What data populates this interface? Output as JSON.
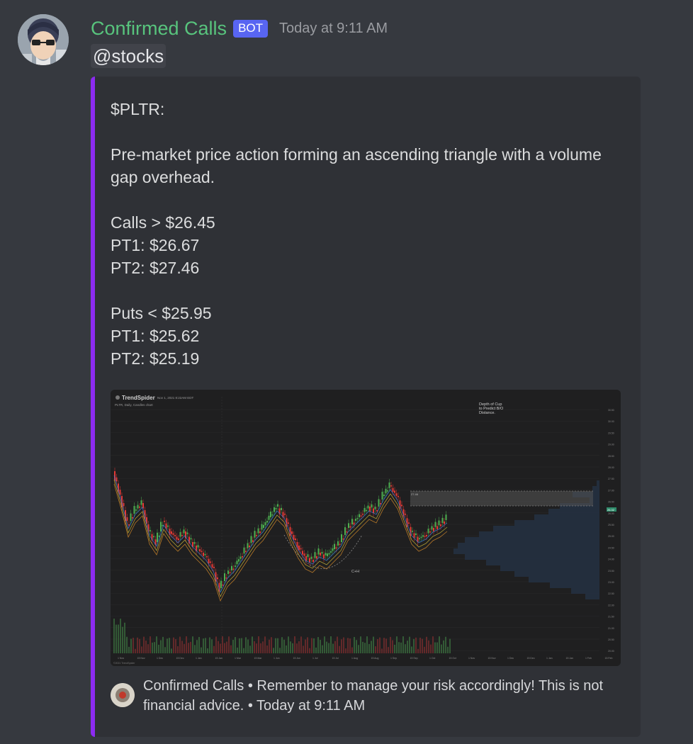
{
  "message": {
    "author": "Confirmed Calls",
    "badge": "BOT",
    "timestamp": "Today at 9:11 AM",
    "mention": "@stocks"
  },
  "embed": {
    "accent_color": "#8c2bf0",
    "description": "$PLTR:\n\nPre-market price action forming an ascending triangle with a volume gap overhead.\n\nCalls > $26.45\nPT1: $26.67\nPT2: $27.46\n\nPuts < $25.95\nPT1: $25.62\nPT2: $25.19",
    "footer_text": "Confirmed Calls • Remember to manage your risk accordingly! This is not financial advice. • Today at 9:11 AM",
    "image": {
      "brand": "TrendSpider",
      "date": "Nov 1, 2021 8:22AM EDT",
      "subtitle": "PLTR, Daily, Candles chart",
      "annotation": "Depth of Cup\nto Predict B/O\nDistance.",
      "pattern_label": "C+H",
      "copyright": "©2021 TrendSpider",
      "price_tag": "26.32",
      "price_labels": [
        "30.50",
        "30.00",
        "29.50",
        "29.00",
        "28.50",
        "28.00",
        "27.50",
        "27.00",
        "26.50",
        "26.00",
        "25.50",
        "25.00",
        "24.50",
        "24.00",
        "23.50",
        "23.00",
        "22.50",
        "22.00",
        "21.50",
        "21.00",
        "20.50",
        "20.00"
      ],
      "date_labels": [
        "1 Nov",
        "15 Nov",
        "1 Dec",
        "15 Dec",
        "1 Jan",
        "15 Jan",
        "1 Mar",
        "15 Mar",
        "1 Jun",
        "15 Jun",
        "1 Jul",
        "15 Jul",
        "1 Aug",
        "15 Aug",
        "1 Sep",
        "15 Sep",
        "1 Oct",
        "15 Oct",
        "1 Nov",
        "15 Nov",
        "1 Dec",
        "15 Dec",
        "1 Jan",
        "15 Jan",
        "1 Feb",
        "15 Feb"
      ]
    }
  },
  "colors": {
    "background": "#36393f",
    "embed_bg": "#2f3136",
    "username": "#58c47d",
    "badge": "#5865f2",
    "chart_up": "#4caf50",
    "chart_down": "#e53935"
  },
  "icons": {
    "avatar": "anime-character-avatar",
    "footer": "confirmed-calls-logo-icon"
  }
}
